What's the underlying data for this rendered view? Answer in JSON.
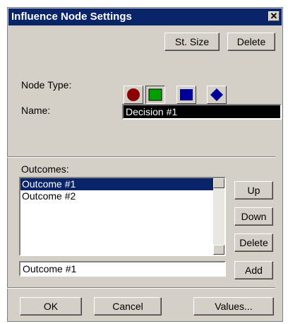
{
  "window": {
    "title": "Influence Node Settings",
    "close_label": "✕"
  },
  "toolbar": {
    "std_size_label": "St. Size",
    "delete_label": "Delete"
  },
  "node_type": {
    "label": "Node Type:",
    "icons": [
      "red-circle-icon",
      "green-square-icon",
      "blue-square-icon",
      "blue-diamond-icon"
    ],
    "colors": {
      "circle": "#8b0000",
      "green": "#00a000",
      "blue": "#000099",
      "diamond": "#000099"
    },
    "selected": "green-square"
  },
  "name": {
    "label": "Name:",
    "value": "Decision #1"
  },
  "outcomes": {
    "label": "Outcomes:",
    "items": [
      "Outcome #1",
      "Outcome #2"
    ],
    "selected_index": 0,
    "up_label": "Up",
    "down_label": "Down",
    "delete_label": "Delete",
    "edit_value": "Outcome #1",
    "add_label": "Add"
  },
  "footer": {
    "ok_label": "OK",
    "cancel_label": "Cancel",
    "values_label": "Values..."
  }
}
